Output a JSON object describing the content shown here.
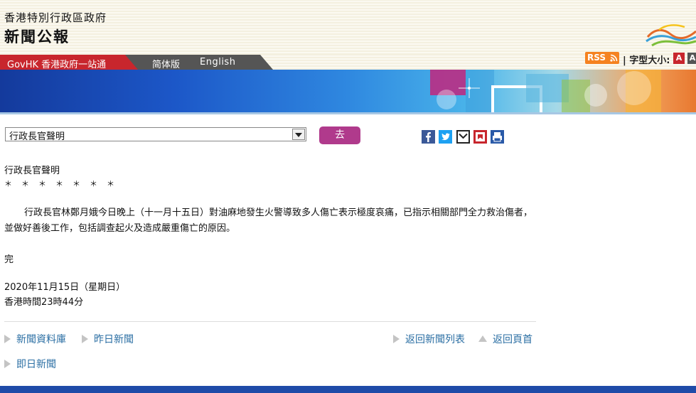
{
  "header": {
    "gov_name": "香港特別行政區政府",
    "press_title": "新聞公報"
  },
  "nav": {
    "govhk": "GovHK 香港政府一站通",
    "simplified": "简体版",
    "english": "English",
    "rss": "RSS",
    "font_size_label": "| 字型大小:",
    "font_small": "A",
    "font_large": "A"
  },
  "category_select": {
    "selected": "行政長官聲明",
    "go_label": "去"
  },
  "share": {
    "icons": [
      "facebook-icon",
      "twitter-icon",
      "email-icon",
      "bookmark-icon",
      "print-icon"
    ],
    "colors": {
      "facebook": "#3b5998",
      "twitter": "#1da1f2",
      "bookmark": "#c8262d",
      "print": "#2a5aa8"
    }
  },
  "article": {
    "title": "行政長官聲明",
    "stars": "＊　＊　＊　＊　＊　＊　＊",
    "body": "行政長官林鄭月娥今日晚上（十一月十五日）對油麻地發生火警導致多人傷亡表示極度哀痛，已指示相關部門全力救治傷者，並做好善後工作，包括調查起火及造成嚴重傷亡的原因。",
    "end": "完",
    "date": "2020年11月15日（星期日）",
    "time": "香港時間23時44分"
  },
  "footer_links": {
    "archive": "新聞資料庫",
    "yesterday": "昨日新聞",
    "back_list": "返回新聞列表",
    "back_top": "返回頁首",
    "today": "即日新聞"
  },
  "colors": {
    "govhk_red": "#c8262d",
    "nav_grey": "#555555",
    "go_button": "#b03a8c",
    "link_blue": "#2a6ea3",
    "bottom_bar": "#1f4ba8"
  }
}
